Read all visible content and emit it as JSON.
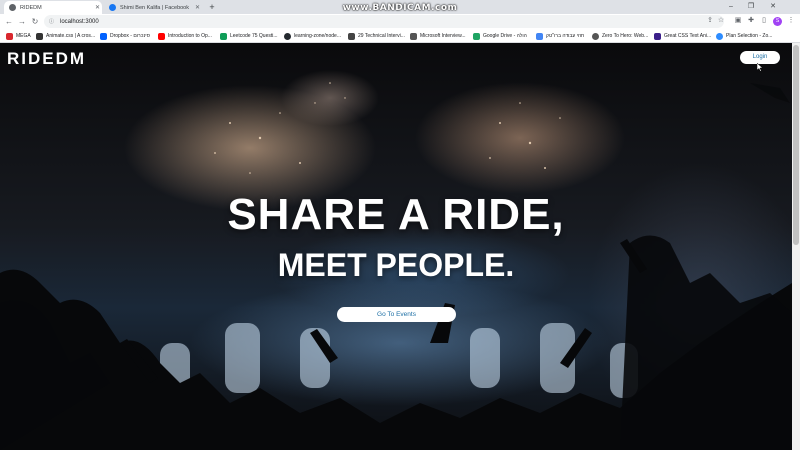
{
  "browser": {
    "tabs": [
      {
        "title": "RIDEDM",
        "active": true,
        "favicon_color": "#5f6368"
      },
      {
        "title": "Shimi Ben Kalifa | Facebook",
        "active": false,
        "favicon_color": "#1877f2"
      }
    ],
    "new_tab_icon": "+",
    "window_controls": {
      "minimize": "–",
      "restore": "❐",
      "close": "✕"
    },
    "address": "localhost:3000",
    "nav": {
      "back": "←",
      "forward": "→",
      "reload": "↻"
    },
    "profile_initial": "S",
    "watermark": "www.BANDICAM.com",
    "bookmarks": [
      {
        "label": "MEGA",
        "color": "#d9272e"
      },
      {
        "label": "Animate.css | A cros...",
        "color": "#333333"
      },
      {
        "label": "Dropbox - סינכרום",
        "color": "#0061fe"
      },
      {
        "label": "Introduction to Op...",
        "color": "#ff0000"
      },
      {
        "label": "Leetcode 75 Questi...",
        "color": "#0f9d58"
      },
      {
        "label": "learning-zone/node...",
        "color": "#24292e"
      },
      {
        "label": "29 Technical Intervi...",
        "color": "#444444"
      },
      {
        "label": "Microsoft Interview...",
        "color": "#555555"
      },
      {
        "label": "Google Drive - הולה",
        "color": "#1fa463"
      },
      {
        "label": "חוזי עבודה ברו\"טק",
        "color": "#4285f4"
      },
      {
        "label": "Zero To Hero: Web...",
        "color": "#555555"
      },
      {
        "label": "Great CSS Text Ani...",
        "color": "#3b1f8a"
      },
      {
        "label": "Plan Selection - Zo...",
        "color": "#2d8cff"
      }
    ]
  },
  "page": {
    "logo": "RIDEDM",
    "login_label": "Login",
    "headline": "SHARE A RIDE,",
    "subheadline": "MEET PEOPLE.",
    "cta_label": "Go To Events",
    "accent_color": "#1d6fa5"
  }
}
